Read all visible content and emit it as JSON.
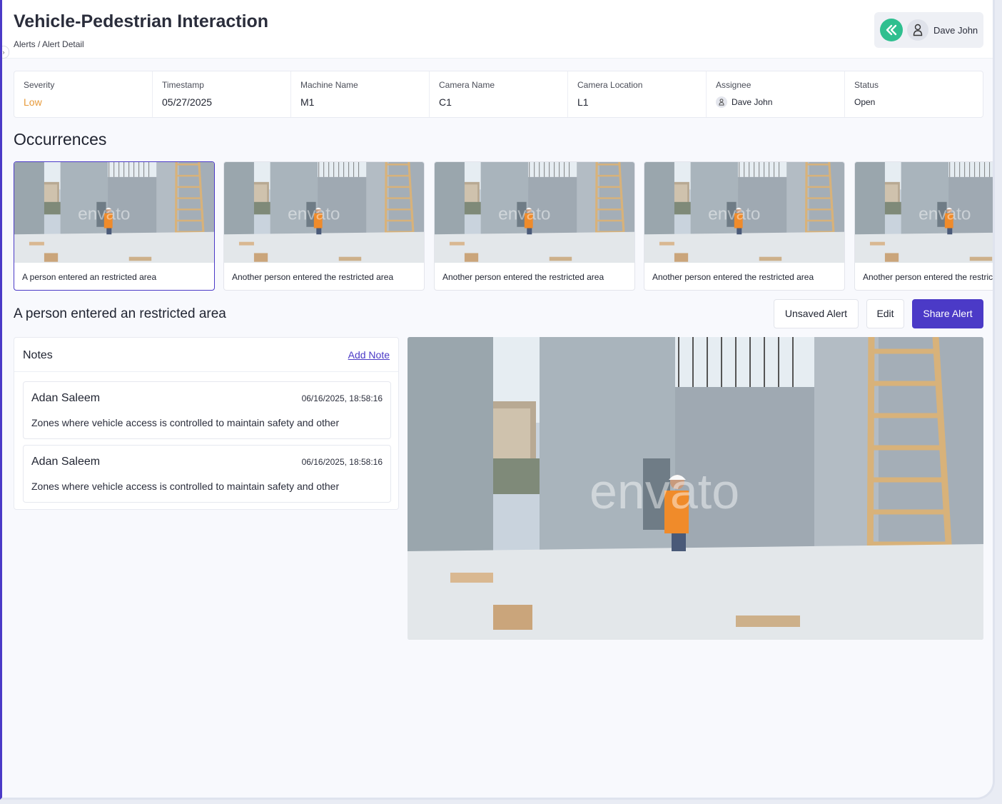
{
  "header": {
    "title": "Vehicle-Pedestrian Interaction",
    "breadcrumb": "Alerts / Alert Detail",
    "user_name": "Dave John"
  },
  "meta": {
    "severity_label": "Severity",
    "severity_value": "Low",
    "timestamp_label": "Timestamp",
    "timestamp_value": "05/27/2025",
    "machine_label": "Machine Name",
    "machine_value": "M1",
    "camera_label": "Camera Name",
    "camera_value": "C1",
    "location_label": "Camera Location",
    "location_value": "L1",
    "assignee_label": "Assignee",
    "assignee_value": "Dave John",
    "status_label": "Status",
    "status_value": "Open"
  },
  "occurrences": {
    "title": "Occurrences",
    "items": [
      {
        "caption": "A person entered an restricted area",
        "selected": true
      },
      {
        "caption": "Another person entered the restricted area",
        "selected": false
      },
      {
        "caption": "Another person entered the restricted area",
        "selected": false
      },
      {
        "caption": "Another person entered the restricted area",
        "selected": false
      },
      {
        "caption": "Another person entered the restricted area",
        "selected": false
      }
    ],
    "watermark": "envato"
  },
  "detail": {
    "title": "A person entered an restricted area",
    "unsaved_label": "Unsaved Alert",
    "edit_label": "Edit",
    "share_label": "Share Alert"
  },
  "notes": {
    "title": "Notes",
    "add_label": "Add Note",
    "items": [
      {
        "author": "Adan Saleem",
        "time": "06/16/2025, 18:58:16",
        "body": "Zones where vehicle access is controlled to maintain safety and other"
      },
      {
        "author": "Adan Saleem",
        "time": "06/16/2025, 18:58:16",
        "body": "Zones where vehicle access is controlled to maintain safety and other"
      }
    ]
  },
  "colors": {
    "accent": "#4b3ac7",
    "severity_low": "#e79a3a",
    "logo_green": "#2fbf8f"
  }
}
